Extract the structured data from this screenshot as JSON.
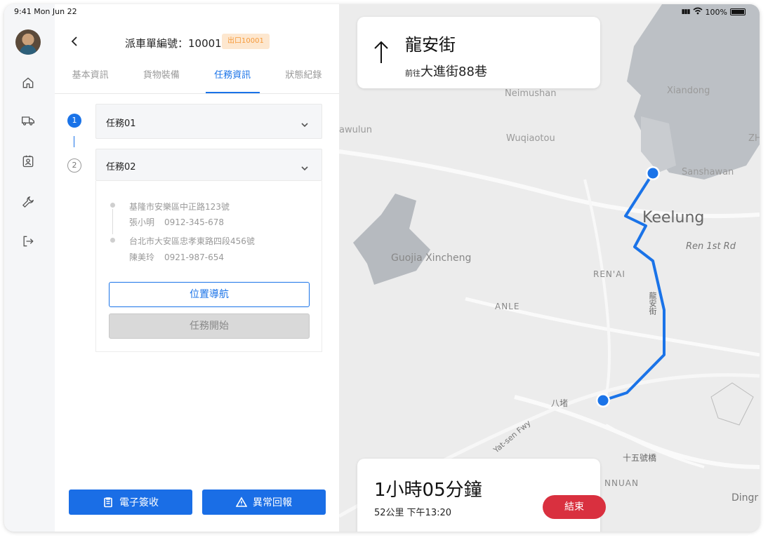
{
  "status_bar": {
    "time": "9:41 Mon Jun 22",
    "signal": "▮▮▮",
    "wifi": "wifi",
    "battery": "100%"
  },
  "sidebar": {
    "items": [
      {
        "name": "home",
        "icon": "home-icon"
      },
      {
        "name": "vehicle",
        "icon": "truck-icon"
      },
      {
        "name": "profile",
        "icon": "id-badge-icon"
      },
      {
        "name": "settings",
        "icon": "wrench-icon"
      },
      {
        "name": "logout",
        "icon": "logout-icon"
      }
    ]
  },
  "header": {
    "title": "派車單編號：10001",
    "badge": "出口10001"
  },
  "tabs": [
    {
      "label": "基本資訊",
      "active": false
    },
    {
      "label": "貨物裝備",
      "active": false
    },
    {
      "label": "任務資訊",
      "active": true
    },
    {
      "label": "狀態紀錄",
      "active": false
    }
  ],
  "tasks": [
    {
      "step": "1",
      "label": "任務01",
      "expanded": false
    },
    {
      "step": "2",
      "label": "任務02",
      "expanded": true
    }
  ],
  "task_detail": {
    "stops": [
      {
        "address": "基隆市安樂區中正路123號",
        "name": "張小明",
        "phone": "0912-345-678"
      },
      {
        "address": "台北市大安區忠孝東路四段456號",
        "name": "陳美玲",
        "phone": "0921-987-654"
      }
    ],
    "nav_button": "位置導航",
    "start_button": "任務開始"
  },
  "bottom_actions": {
    "sign_label": "電子簽收",
    "report_label": "異常回報"
  },
  "map": {
    "labels": {
      "neimushan": "Neimushan",
      "xiandong": "Xiandong",
      "awulun": "awulun",
      "wuqiaotou": "Wuqiaotou",
      "zh": "ZH",
      "sanshawan": "Sanshawan",
      "keelung": "Keelung",
      "ren1st": "Ren 1st Rd",
      "guojia": "Guojia Xincheng",
      "renai": "REN'AI",
      "longan": "龍安街",
      "anle": "ANLE",
      "bandu": "八堵",
      "yatsen": "Yat-sen Fwy",
      "shiwu": "十五號橋",
      "nuan": "NNUAN",
      "dingr": "Dingr"
    },
    "route_color": "#1a73e8"
  },
  "navigation": {
    "arrow": "up-arrow-icon",
    "street": "龍安街",
    "prefix": "前往",
    "destination": "大進街88巷"
  },
  "eta": {
    "duration": "1小時05分鐘",
    "distance": "52公里",
    "arrival": "下午13:20",
    "end_button": "結束"
  }
}
